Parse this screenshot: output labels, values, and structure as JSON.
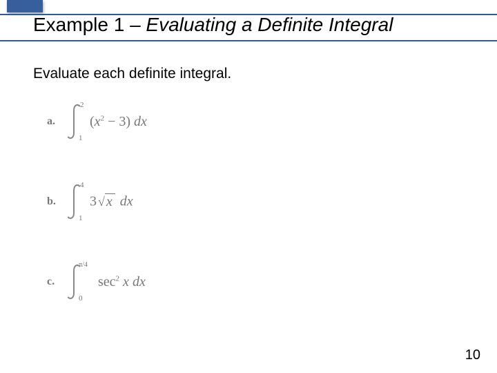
{
  "title": {
    "prefix": "Example 1 – ",
    "italic": "Evaluating a Definite Integral"
  },
  "instruction": "Evaluate each definite integral.",
  "problems": {
    "a": {
      "label": "a.",
      "upper": "2",
      "lower": "1",
      "integrand_open": "(",
      "integrand_var": "x",
      "integrand_pow": "2",
      "integrand_minus": " − 3)",
      "dx": " dx"
    },
    "b": {
      "label": "b.",
      "upper": "4",
      "lower": "1",
      "coeff": "3",
      "radicand": "x",
      "dx": " dx"
    },
    "c": {
      "label": "c.",
      "upper": "π/4",
      "lower": "0",
      "func": "sec",
      "pow": "2",
      "arg": " x",
      "dx": " dx"
    }
  },
  "page": "10"
}
